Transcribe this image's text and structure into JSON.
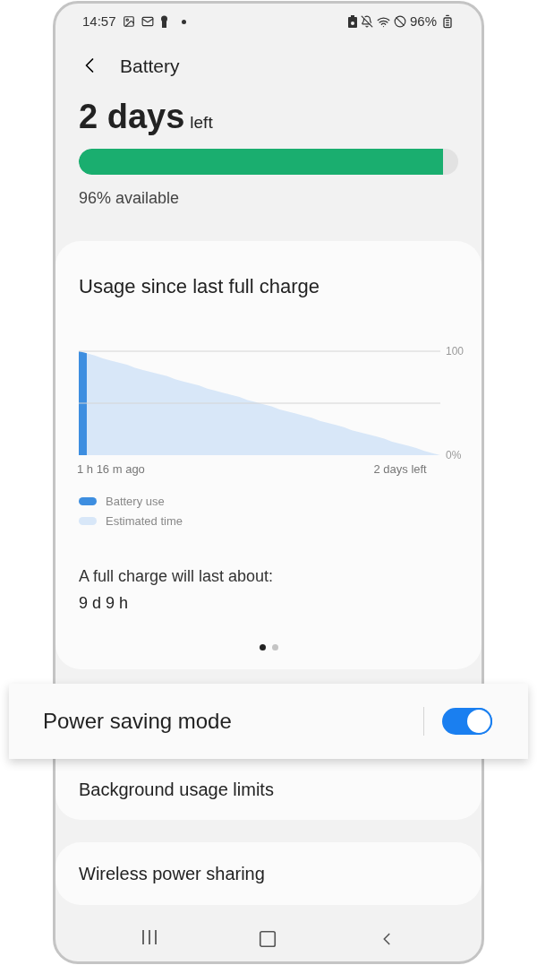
{
  "status_bar": {
    "time": "14:57",
    "battery": "96%"
  },
  "header": {
    "title": "Battery"
  },
  "summary": {
    "value": "2 days",
    "unit": "left",
    "level": 0.96,
    "available": "96% available"
  },
  "usage_card": {
    "title": "Usage since last full charge",
    "chart_data": {
      "type": "area",
      "categories": [
        null,
        null,
        null,
        null,
        "1 h 16 m ago",
        null,
        null,
        null,
        null,
        null,
        null,
        null,
        null,
        null,
        null,
        null,
        null,
        null,
        null,
        null,
        null,
        null,
        null,
        null,
        null,
        null,
        null,
        null,
        null,
        null,
        null,
        null,
        null,
        null,
        null,
        null,
        null,
        null,
        null,
        null,
        "2 days left",
        null,
        null,
        null,
        null,
        null
      ],
      "legend": "bottom-left",
      "ylim": [
        0,
        100
      ],
      "yticks": [
        {
          "value": 100,
          "label": "100"
        },
        {
          "value": 50,
          "label": null
        },
        {
          "value": 0,
          "label": "0%"
        }
      ],
      "series": [
        {
          "name": "Battery use",
          "color": "#3d8ee0",
          "values": [
            100,
            98,
            null,
            null,
            null,
            null,
            null,
            null,
            null,
            null,
            null,
            null,
            null,
            null,
            null,
            null,
            null,
            null,
            null,
            null,
            null,
            null,
            null,
            null,
            null,
            null,
            null,
            null,
            null,
            null,
            null,
            null,
            null,
            null,
            null,
            null,
            null,
            null,
            null,
            null,
            null,
            null,
            null,
            null,
            null,
            null
          ]
        },
        {
          "name": "Estimated time",
          "color": "#d8e7f8",
          "values": [
            100,
            98,
            96,
            93,
            91,
            89,
            87,
            84,
            82,
            80,
            78,
            76,
            73,
            71,
            69,
            67,
            64,
            62,
            60,
            58,
            56,
            53,
            51,
            49,
            47,
            44,
            42,
            40,
            38,
            36,
            33,
            31,
            29,
            27,
            24,
            22,
            20,
            18,
            16,
            13,
            11,
            9,
            7,
            4,
            2,
            0
          ]
        }
      ]
    },
    "full_charge_label": "A full charge will last about:",
    "full_charge_value": "9 d 9 h",
    "pages": [
      {
        "selected": true
      },
      {
        "selected": false
      }
    ]
  },
  "settings": [
    {
      "label": "Power saving mode",
      "kind": "toggle",
      "on": true
    },
    {
      "label": "Background usage limits",
      "kind": "link"
    },
    {
      "label": "Wireless power sharing",
      "kind": "link"
    }
  ]
}
